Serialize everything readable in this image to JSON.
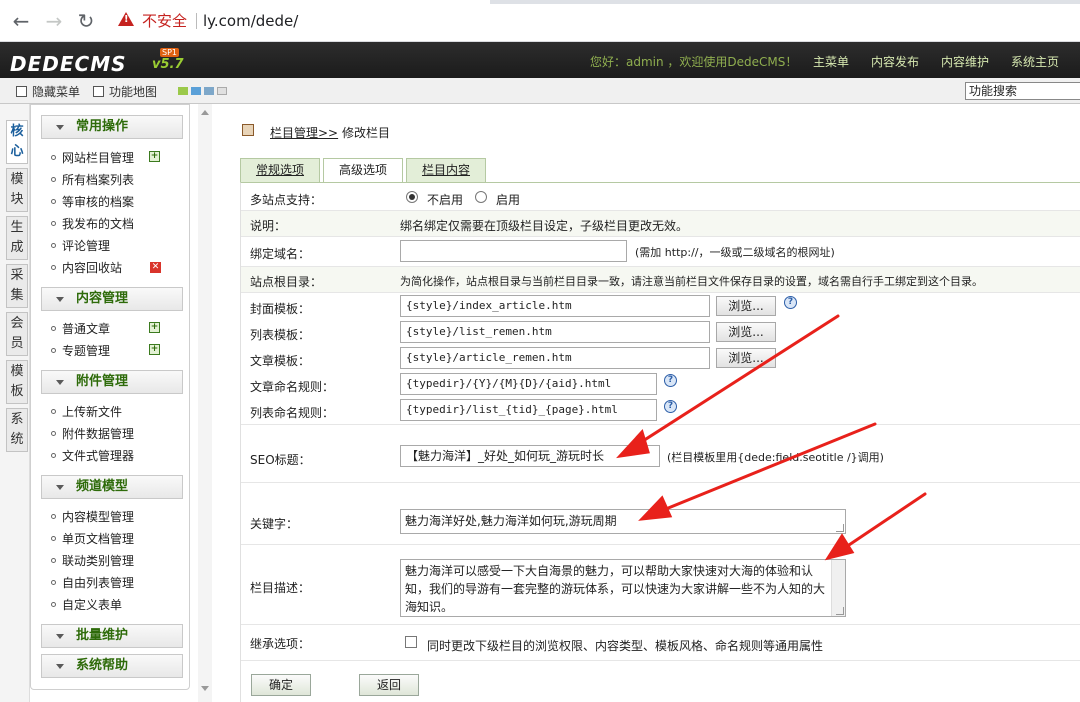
{
  "browser": {
    "insecure_label": "不安全",
    "url": "ly.com/dede/"
  },
  "header": {
    "logo_text": "DEDECMS",
    "logo_version": "v5.7",
    "logo_badge": "SP1",
    "welcome": "您好：admin ，欢迎使用DedeCMS！",
    "menu": [
      "主菜单",
      "内容发布",
      "内容维护",
      "系统主页"
    ]
  },
  "toolbar": {
    "hide_menu": "隐藏菜单",
    "site_map": "功能地图",
    "search_placeholder": "功能搜索",
    "swatches": [
      "#9bc94a",
      "#5aa0d8",
      "#7da7c9",
      "#e0e0e0"
    ]
  },
  "vtabs": [
    "核心",
    "模块",
    "生成",
    "采集",
    "会员",
    "模板",
    "系统"
  ],
  "leftmenu": {
    "groups": [
      {
        "title": "常用操作",
        "items": [
          "网站栏目管理",
          "所有档案列表",
          "等审核的档案",
          "我发布的文档",
          "评论管理",
          "内容回收站"
        ]
      },
      {
        "title": "内容管理",
        "items": [
          "普通文章",
          "专题管理"
        ]
      },
      {
        "title": "附件管理",
        "items": [
          "上传新文件",
          "附件数据管理",
          "文件式管理器"
        ]
      },
      {
        "title": "频道模型",
        "items": [
          "内容模型管理",
          "单页文档管理",
          "联动类别管理",
          "自由列表管理",
          "自定义表单"
        ]
      },
      {
        "title": "批量维护",
        "items": []
      },
      {
        "title": "系统帮助",
        "items": []
      }
    ]
  },
  "breadcrumb": {
    "link": "栏目管理>>",
    "current": "修改栏目"
  },
  "tabs": [
    "常规选项",
    "高级选项",
    "栏目内容"
  ],
  "form": {
    "multisite_label": "多站点支持：",
    "multisite_off": "不启用",
    "multisite_on": "启用",
    "note_label": "说明：",
    "note_text": "绑名绑定仅需要在顶级栏目设定，子级栏目更改无效。",
    "domain_label": "绑定域名：",
    "domain_value": "",
    "domain_hint": "(需加 http://，一级或二级域名的根网址)",
    "root_label": "站点根目录：",
    "root_text": "为简化操作，站点根目录与当前栏目目录一致，请注意当前栏目文件保存目录的设置，域名需自行手工绑定到这个目录。",
    "cover_tpl_label": "封面模板：",
    "cover_tpl_value": "{style}/index_article.htm",
    "list_tpl_label": "列表模板：",
    "list_tpl_value": "{style}/list_remen.htm",
    "article_tpl_label": "文章模板：",
    "article_tpl_value": "{style}/article_remen.htm",
    "browse_label": "浏览...",
    "article_rule_label": "文章命名规则：",
    "article_rule_value": "{typedir}/{Y}/{M}{D}/{aid}.html",
    "list_rule_label": "列表命名规则：",
    "list_rule_value": "{typedir}/list_{tid}_{page}.html",
    "seo_label": "SEO标题：",
    "seo_value": "【魅力海洋】_好处_如何玩_游玩时长",
    "seo_hint": "(栏目模板里用{dede:field.seotitle /}调用)",
    "keywords_label": "关键字：",
    "keywords_value": "魅力海洋好处,魅力海洋如何玩,游玩周期",
    "desc_label": "栏目描述：",
    "desc_value": "魅力海洋可以感受一下大自海景的魅力，可以帮助大家快速对大海的体验和认知，我们的导游有一套完整的游玩体系，可以快速为大家讲解一些不为人知的大海知识。",
    "inherit_label": "继承选项：",
    "inherit_text": "同时更改下级栏目的浏览权限、内容类型、模板风格、命名规则等通用属性"
  },
  "actions": {
    "ok": "确定",
    "back": "返回"
  }
}
